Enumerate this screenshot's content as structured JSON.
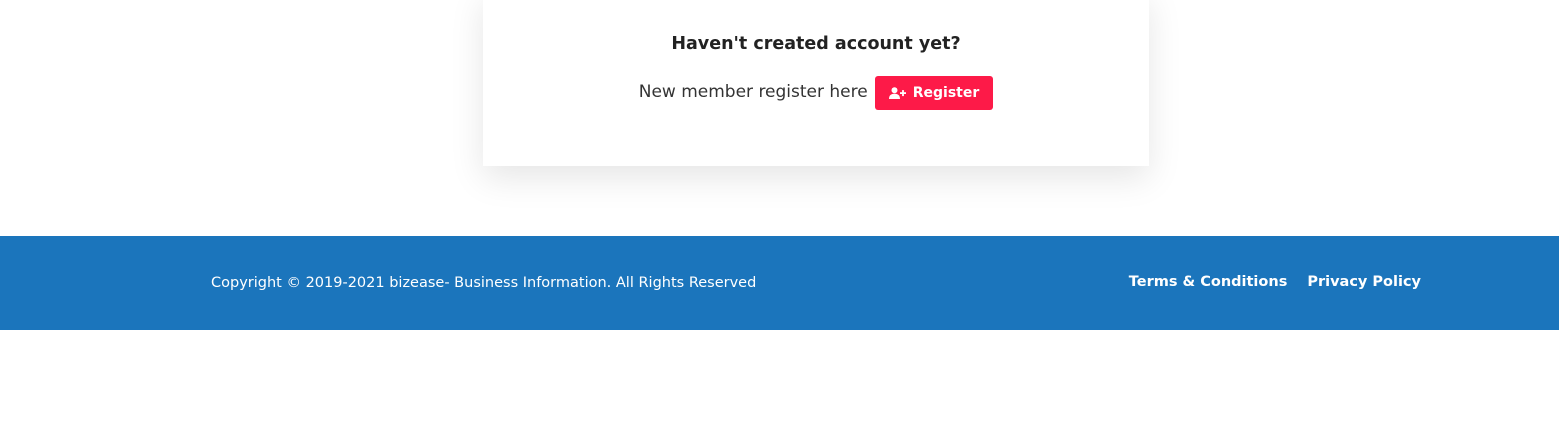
{
  "register_card": {
    "title": "Haven't created account yet?",
    "prompt_text": "New member register here",
    "register_button_label": "Register",
    "register_button_icon": "user-plus-icon"
  },
  "footer": {
    "copyright": "Copyright © 2019-2021 bizease- Business Information. All Rights Reserved",
    "links": [
      {
        "label": "Terms & Conditions"
      },
      {
        "label": "Privacy Policy"
      }
    ]
  },
  "colors": {
    "accent": "#fd1a48",
    "footer_background": "#1b75bc",
    "page_background": "#ffffff"
  }
}
